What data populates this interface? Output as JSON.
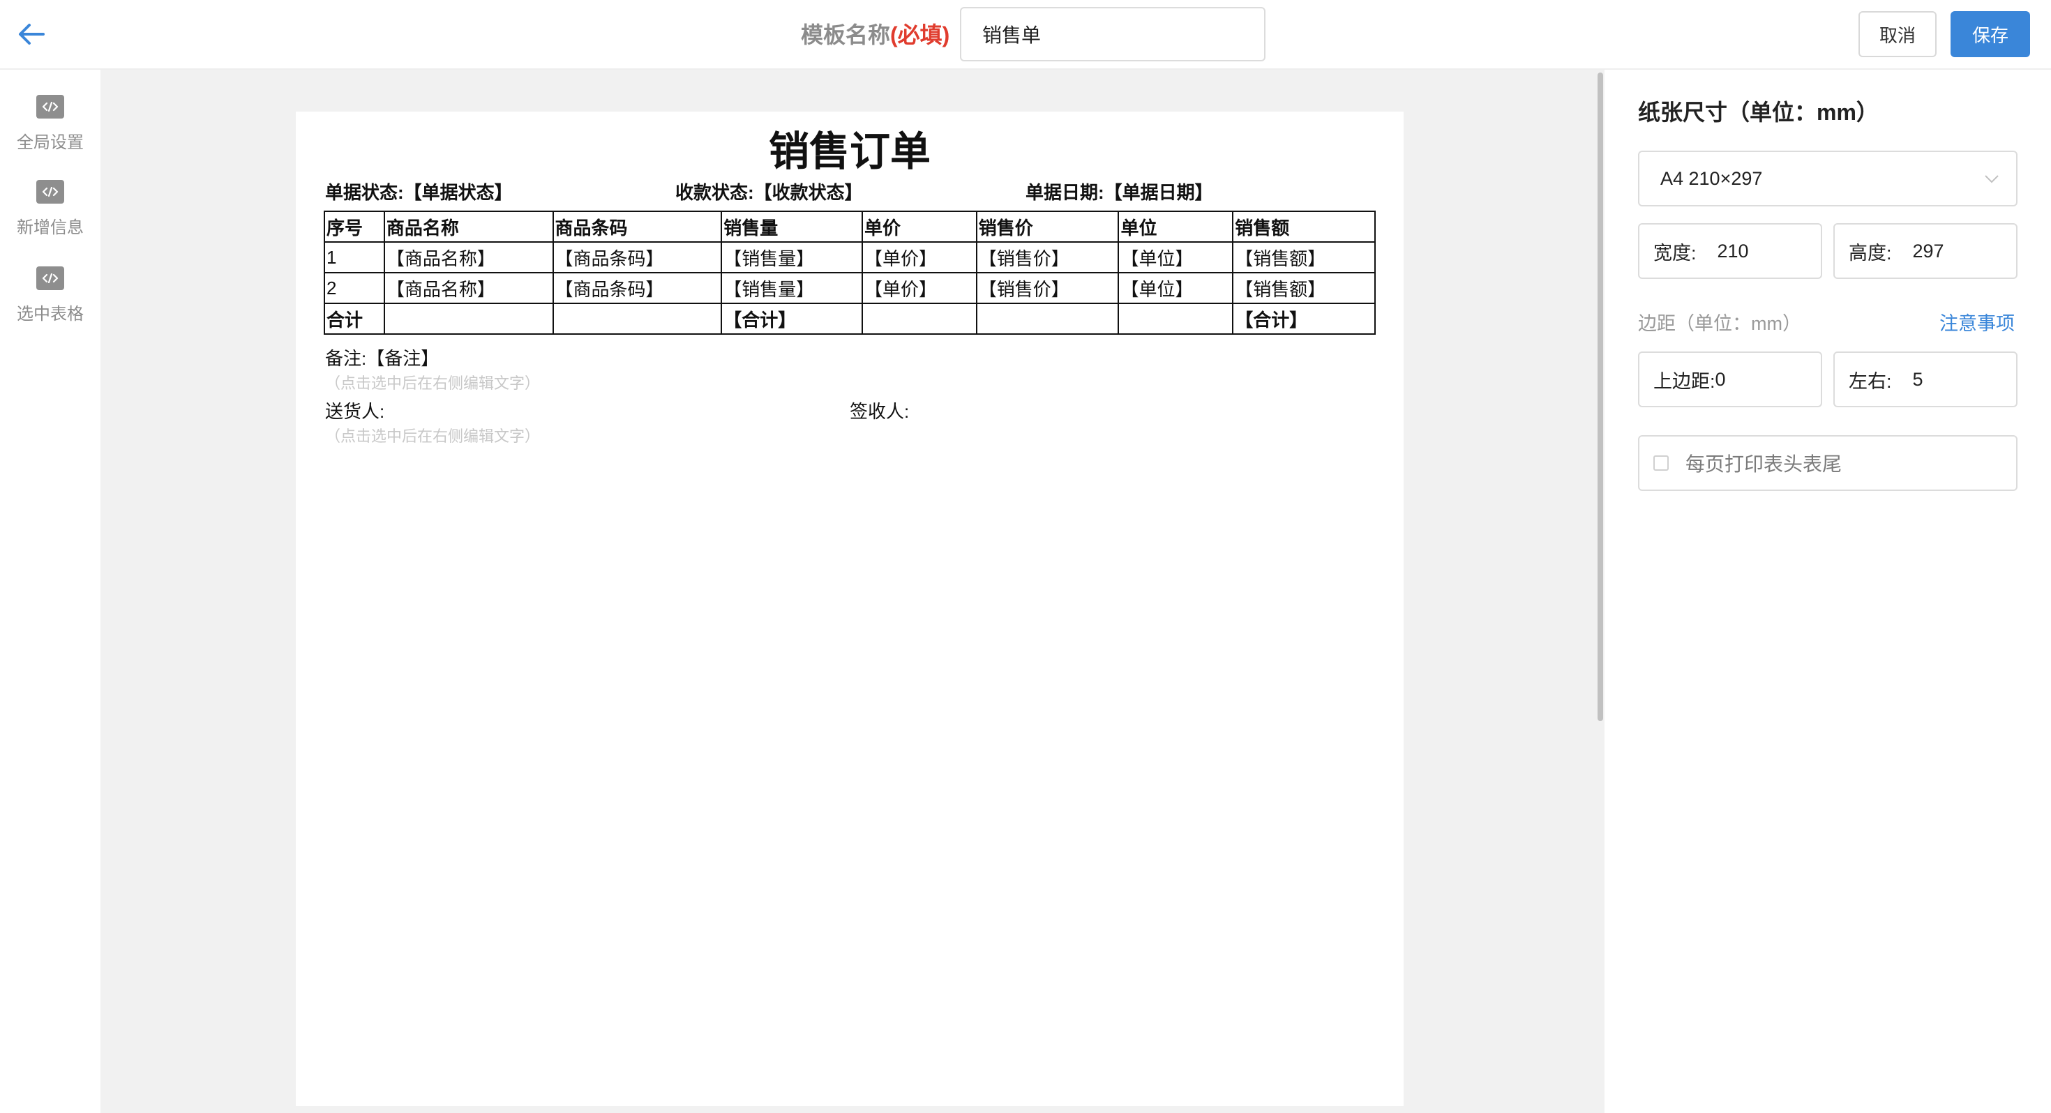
{
  "header": {
    "template_name_label": "模板名称",
    "required_mark": "(必填)",
    "template_name_value": "销售单",
    "cancel_label": "取消",
    "save_label": "保存"
  },
  "sidebar": {
    "items": [
      {
        "label": "全局设置",
        "icon": "code-icon"
      },
      {
        "label": "新增信息",
        "icon": "code-icon"
      },
      {
        "label": "选中表格",
        "icon": "code-icon"
      }
    ]
  },
  "document": {
    "title": "销售订单",
    "meta": [
      {
        "label": "单据状态:",
        "value": "【单据状态】"
      },
      {
        "label": "收款状态:",
        "value": "【收款状态】"
      },
      {
        "label": "单据日期:",
        "value": "【单据日期】"
      }
    ],
    "table": {
      "headers": [
        "序号",
        "商品名称",
        "商品条码",
        "销售量",
        "单价",
        "销售价",
        "单位",
        "销售额"
      ],
      "rows": [
        [
          "1",
          "【商品名称】",
          "【商品条码】",
          "【销售量】",
          "【单价】",
          "【销售价】",
          "【单位】",
          "【销售额】"
        ],
        [
          "2",
          "【商品名称】",
          "【商品条码】",
          "【销售量】",
          "【单价】",
          "【销售价】",
          "【单位】",
          "【销售额】"
        ]
      ],
      "sum_row": [
        "合计",
        "",
        "",
        "【合计】",
        "",
        "",
        "",
        "【合计】"
      ]
    },
    "remark_label": "备注:",
    "remark_value": "【备注】",
    "hint_text": "（点击选中后在右侧编辑文字）",
    "delivery_label": "送货人:",
    "receiver_label": "签收人:"
  },
  "settings": {
    "paper_size_title": "纸张尺寸（单位：mm）",
    "paper_size_value": "A4 210×297",
    "width_label": "宽度:",
    "width_value": "210",
    "height_label": "高度:",
    "height_value": "297",
    "margin_label": "边距（单位：mm）",
    "notes_link": "注意事项",
    "top_margin_label": "上边距:",
    "top_margin_value": "0",
    "side_margin_label": "左右:",
    "side_margin_value": "5",
    "print_header_footer_label": "每页打印表头表尾"
  },
  "colors": {
    "accent": "#3a86d9",
    "required": "#e03c2e",
    "canvas_bg": "#f1f1f1"
  }
}
